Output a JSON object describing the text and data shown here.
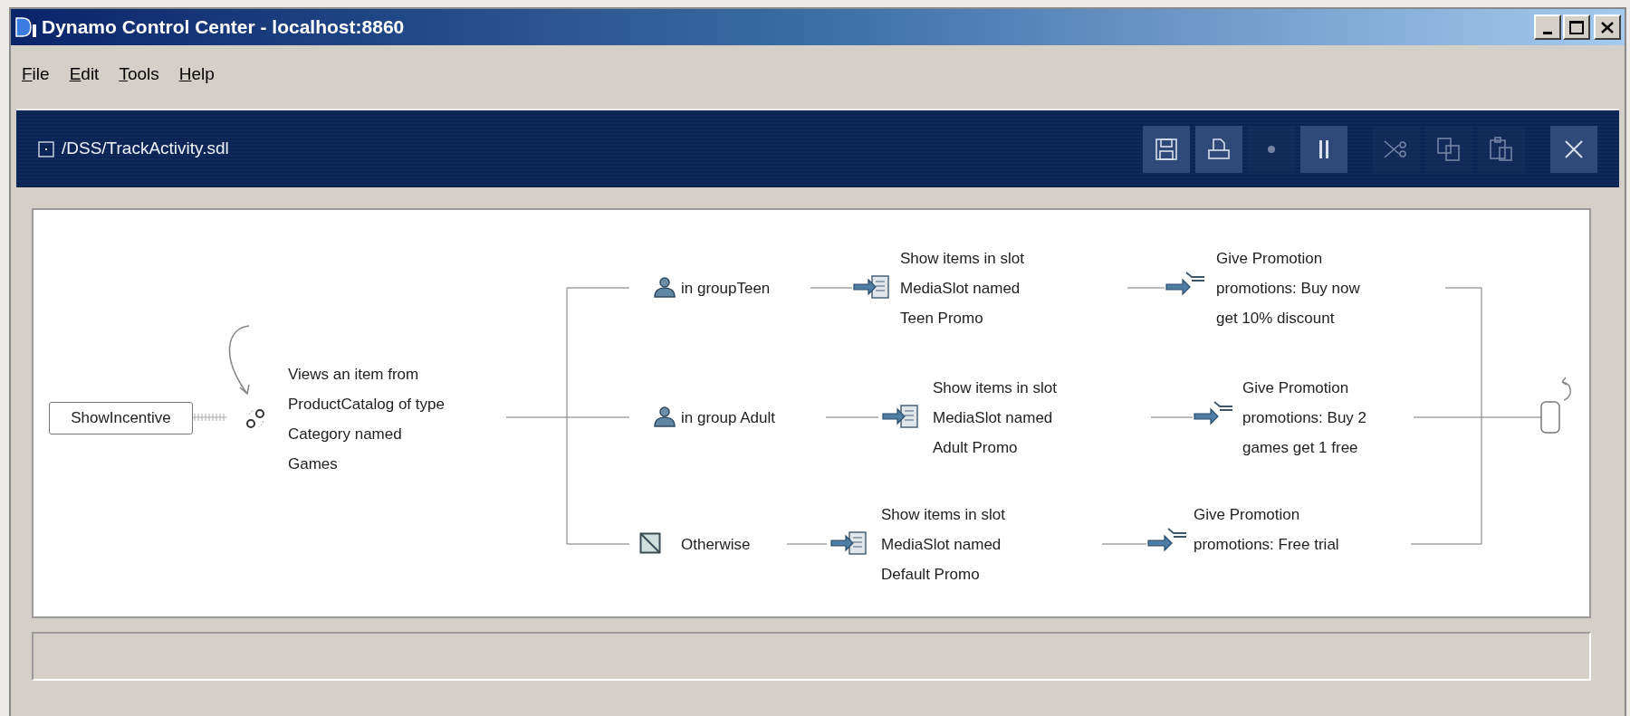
{
  "window": {
    "title": "Dynamo Control Center - localhost:8860"
  },
  "menu": [
    {
      "label": "File"
    },
    {
      "label": "Edit"
    },
    {
      "label": "Tools"
    },
    {
      "label": "Help"
    }
  ],
  "document": {
    "path": "/DSS/TrackActivity.sdl"
  },
  "toolbar": [
    {
      "kind": "save",
      "disabled": false
    },
    {
      "kind": "print",
      "disabled": false
    },
    {
      "kind": "record",
      "disabled": true
    },
    {
      "kind": "pause",
      "disabled": false
    },
    {
      "kind": "cut",
      "disabled": true
    },
    {
      "kind": "copy",
      "disabled": true
    },
    {
      "kind": "paste",
      "disabled": true
    },
    {
      "kind": "close",
      "disabled": false
    }
  ],
  "diagram": {
    "start": {
      "label": "ShowIncentive"
    },
    "trigger": {
      "lines": [
        "Views an item from",
        "ProductCatalog of type",
        "Category named",
        "Games"
      ]
    },
    "branches": [
      {
        "kind": "group",
        "condition": "in groupTeen",
        "action": [
          "Show items in slot",
          "MediaSlot named",
          "Teen Promo"
        ],
        "promotion": [
          "Give Promotion",
          "promotions: Buy now",
          "get 10% discount"
        ]
      },
      {
        "kind": "group",
        "condition": "in group Adult",
        "action": [
          "Show items in slot",
          "MediaSlot named",
          "Adult Promo"
        ],
        "promotion": [
          "Give Promotion",
          "promotions: Buy 2",
          "games get 1 free"
        ]
      },
      {
        "kind": "otherwise",
        "condition": "Otherwise",
        "action": [
          "Show items in slot",
          "MediaSlot named",
          "Default Promo"
        ],
        "promotion": [
          "Give Promotion",
          "promotions: Free trial"
        ]
      }
    ]
  }
}
